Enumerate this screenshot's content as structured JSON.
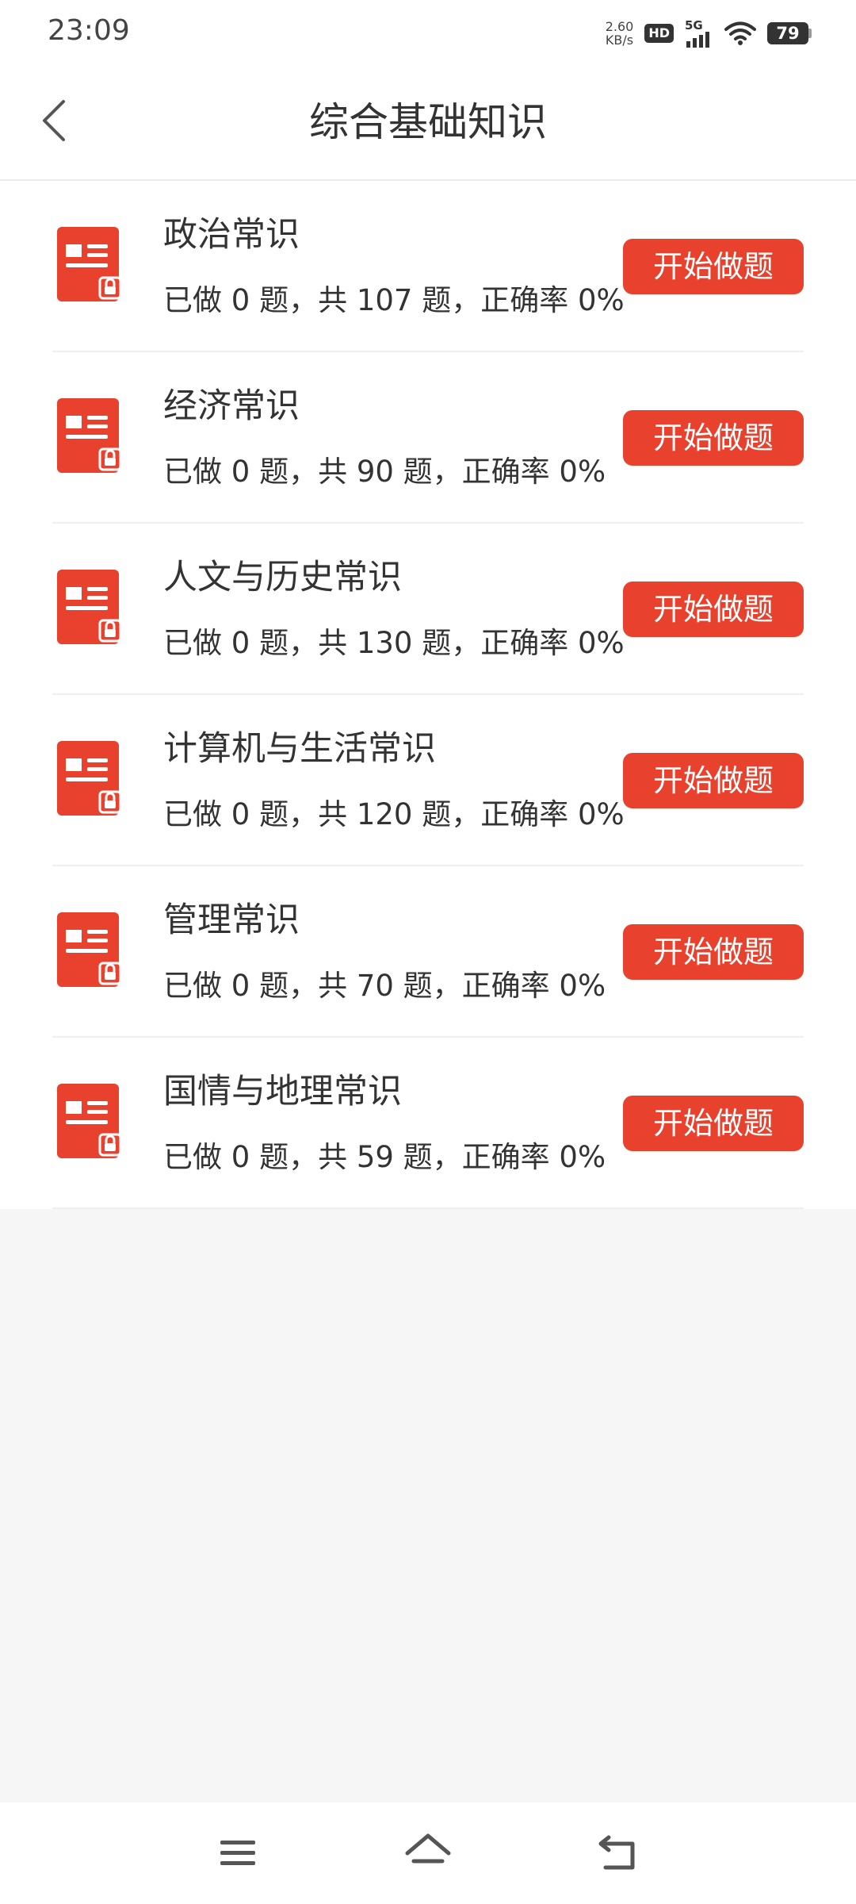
{
  "status_bar": {
    "time": "23:09",
    "net_speed_value": "2.60",
    "net_speed_unit": "KB/s",
    "hd_label": "HD",
    "signal_label": "5G",
    "battery_level": "79"
  },
  "header": {
    "title": "综合基础知识"
  },
  "colors": {
    "accent": "#e8412d",
    "background": "#f6f6f6"
  },
  "categories": [
    {
      "title": "政治常识",
      "stats": "已做 0 题，共 107 题，正确率 0%",
      "button_label": "开始做题"
    },
    {
      "title": "经济常识",
      "stats": "已做 0 题，共 90 题，正确率 0%",
      "button_label": "开始做题"
    },
    {
      "title": "人文与历史常识",
      "stats": "已做 0 题，共 130 题，正确率 0%",
      "button_label": "开始做题"
    },
    {
      "title": "计算机与生活常识",
      "stats": "已做 0 题，共 120 题，正确率 0%",
      "button_label": "开始做题"
    },
    {
      "title": "管理常识",
      "stats": "已做 0 题，共 70 题，正确率 0%",
      "button_label": "开始做题"
    },
    {
      "title": "国情与地理常识",
      "stats": "已做 0 题，共 59 题，正确率 0%",
      "button_label": "开始做题"
    }
  ],
  "icons": {
    "back": "chevron-left-icon",
    "item": "locked-document-icon",
    "menu": "menu-icon",
    "home": "home-icon",
    "return": "return-icon"
  }
}
